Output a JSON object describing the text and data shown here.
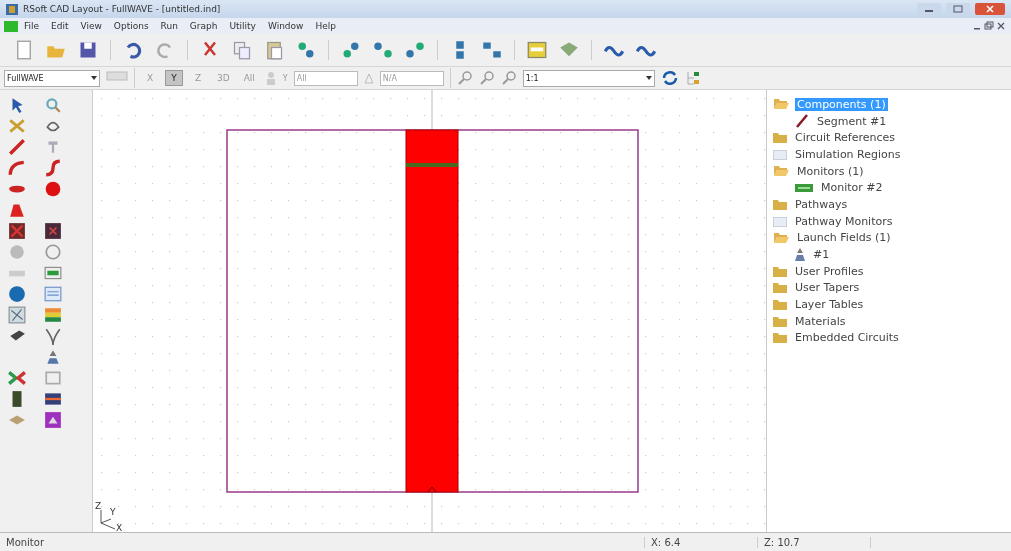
{
  "window": {
    "title": "RSoft CAD Layout - FullWAVE - [untitled.ind]"
  },
  "menu": [
    "File",
    "Edit",
    "View",
    "Options",
    "Run",
    "Graph",
    "Utility",
    "Window",
    "Help"
  ],
  "view_toolbar": {
    "program": "FullWAVE",
    "axis_buttons": [
      {
        "label": "X",
        "pressed": false
      },
      {
        "label": "Y",
        "pressed": true
      },
      {
        "label": "Z",
        "pressed": false
      },
      {
        "label": "3D",
        "pressed": false
      },
      {
        "label": "All",
        "pressed": false
      }
    ],
    "y_label": "Y",
    "y_value": "All",
    "a_value": "N/A",
    "zoom": "1:1"
  },
  "canvas": {
    "axis_labels": [
      "Z",
      "Y",
      "X"
    ]
  },
  "tree": [
    {
      "label": "Components (1)",
      "kind": "group",
      "expanded": true,
      "selected": true,
      "children": [
        {
          "label": "Segment #1",
          "kind": "segment",
          "selected": false
        }
      ]
    },
    {
      "label": "Circuit References",
      "kind": "group",
      "expanded": false,
      "selected": false
    },
    {
      "label": "Simulation Regions",
      "kind": "empty",
      "selected": false
    },
    {
      "label": "Monitors (1)",
      "kind": "group",
      "expanded": true,
      "selected": false,
      "children": [
        {
          "label": "Monitor #2",
          "kind": "monitor",
          "selected": false
        }
      ]
    },
    {
      "label": "Pathways",
      "kind": "group",
      "expanded": false,
      "selected": false
    },
    {
      "label": "Pathway Monitors",
      "kind": "empty",
      "selected": false
    },
    {
      "label": "Launch Fields (1)",
      "kind": "group",
      "expanded": true,
      "selected": false,
      "children": [
        {
          "label": "#1",
          "kind": "launch",
          "selected": false
        }
      ]
    },
    {
      "label": "User Profiles",
      "kind": "group",
      "expanded": false,
      "selected": false
    },
    {
      "label": "User Tapers",
      "kind": "group",
      "expanded": false,
      "selected": false
    },
    {
      "label": "Layer Tables",
      "kind": "group",
      "expanded": false,
      "selected": false
    },
    {
      "label": "Materials",
      "kind": "group",
      "expanded": false,
      "selected": false
    },
    {
      "label": "Embedded Circuits",
      "kind": "group",
      "expanded": false,
      "selected": false
    }
  ],
  "status_bar": {
    "message": "Monitor",
    "x": "X: 6.4",
    "z": "Z: 10.7"
  }
}
